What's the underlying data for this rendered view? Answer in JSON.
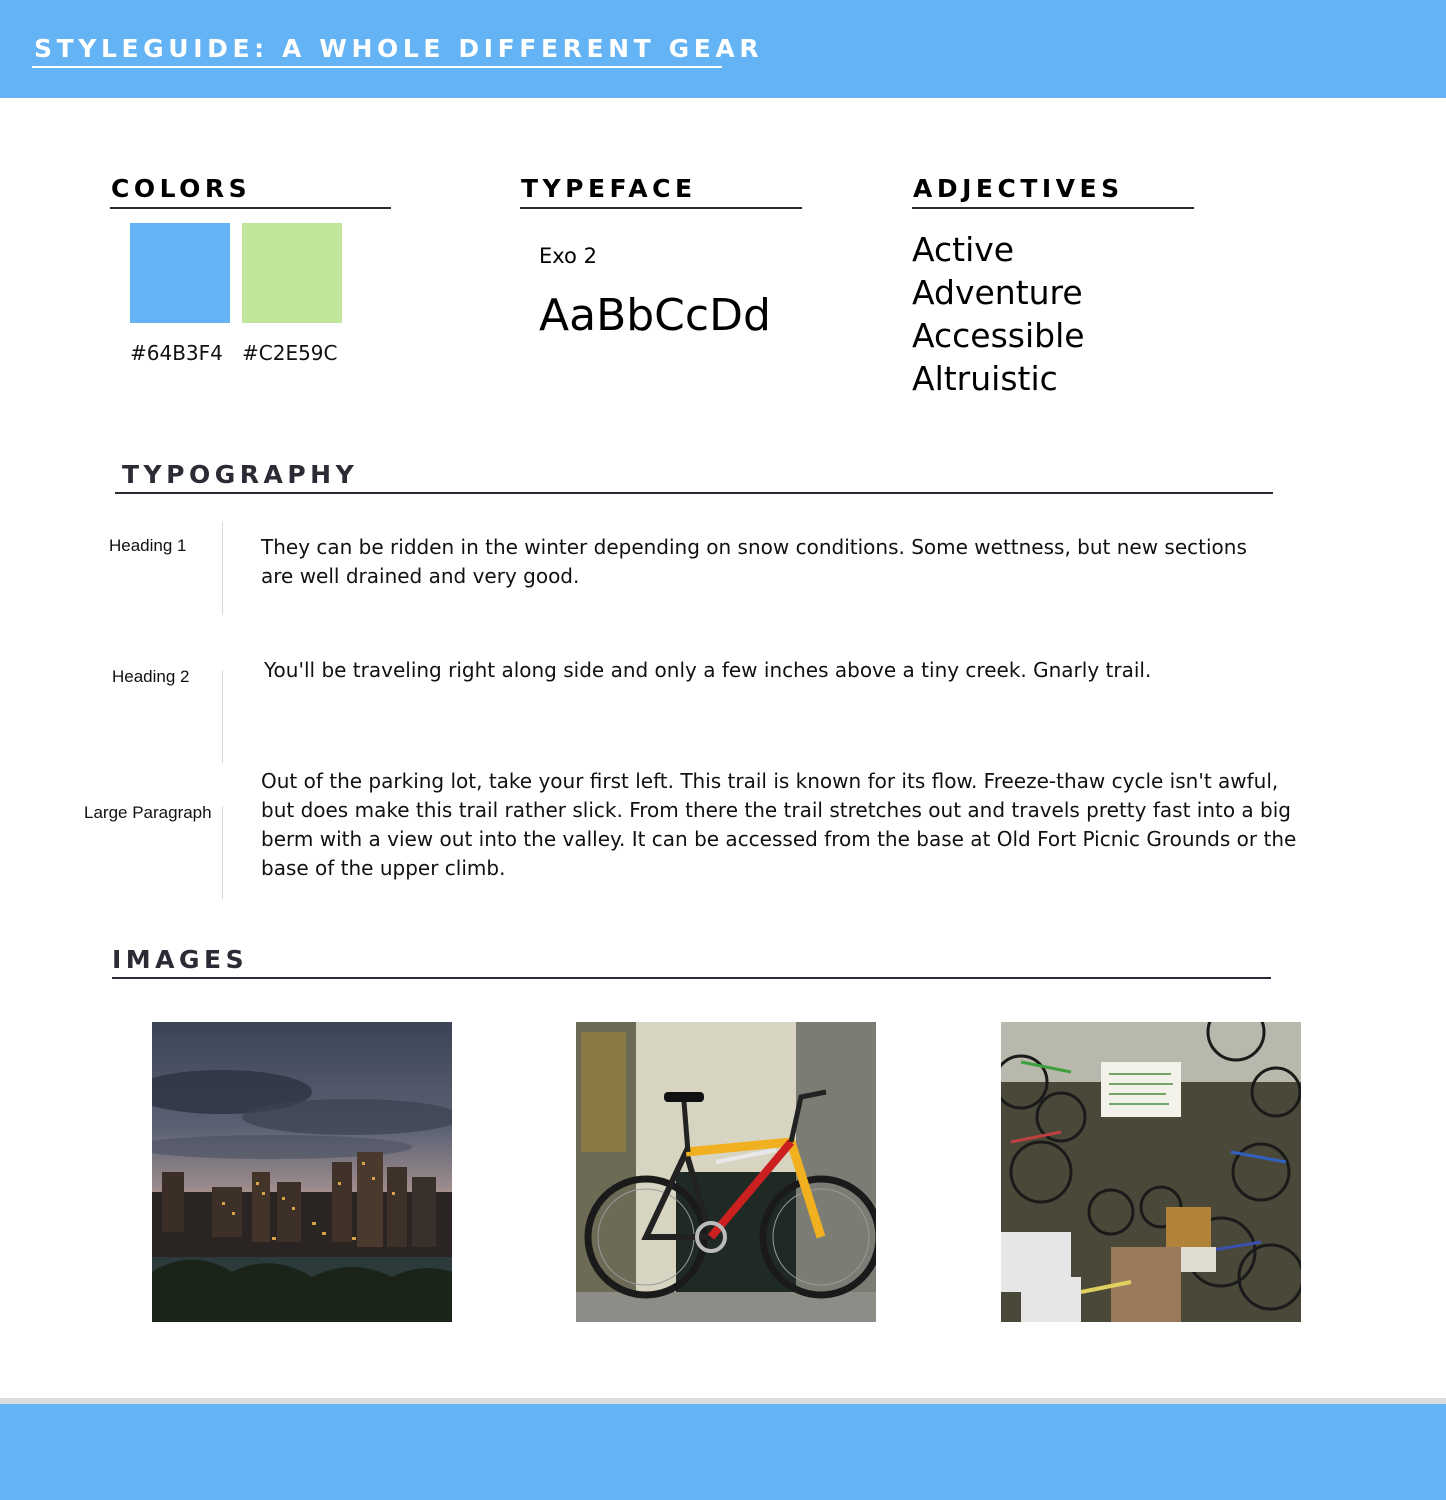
{
  "header": {
    "title": "STYLEGUIDE: A WHOLE DIFFERENT GEAR"
  },
  "colors": {
    "heading": "COLORS",
    "swatches": [
      {
        "hex": "#64B3F4",
        "label": "#64B3F4"
      },
      {
        "hex": "#C2E59C",
        "label": "#C2E59C"
      }
    ]
  },
  "typeface": {
    "heading": "TYPEFACE",
    "name": "Exo 2",
    "sample": "AaBbCcDd"
  },
  "adjectives": {
    "heading": "ADJECTIVES",
    "items": [
      "Active",
      "Adventure",
      "Accessible",
      "Altruistic"
    ]
  },
  "typography": {
    "heading": "TYPOGRAPHY",
    "rows": [
      {
        "label": "Heading 1",
        "text": "They can be ridden in the winter depending on snow conditions. Some wettness, but new sections are well drained and very good."
      },
      {
        "label": "Heading 2",
        "text": "You'll be traveling right along side and only a few inches above a tiny creek. Gnarly trail."
      },
      {
        "label": "Large Paragraph",
        "text": "Out of the parking lot, take your first left. This trail is known for its flow. Freeze-thaw cycle isn't awful, but does make this trail rather slick. From there the trail stretches out and travels pretty fast into a big berm with a view out into the valley. It can be accessed from the base at Old Fort Picnic Grounds or the base of the upper climb."
      }
    ]
  },
  "images": {
    "heading": "IMAGES"
  },
  "theme": {
    "primary": "#64B3F4",
    "secondary": "#C2E59C",
    "rule": "#2b2b35"
  }
}
